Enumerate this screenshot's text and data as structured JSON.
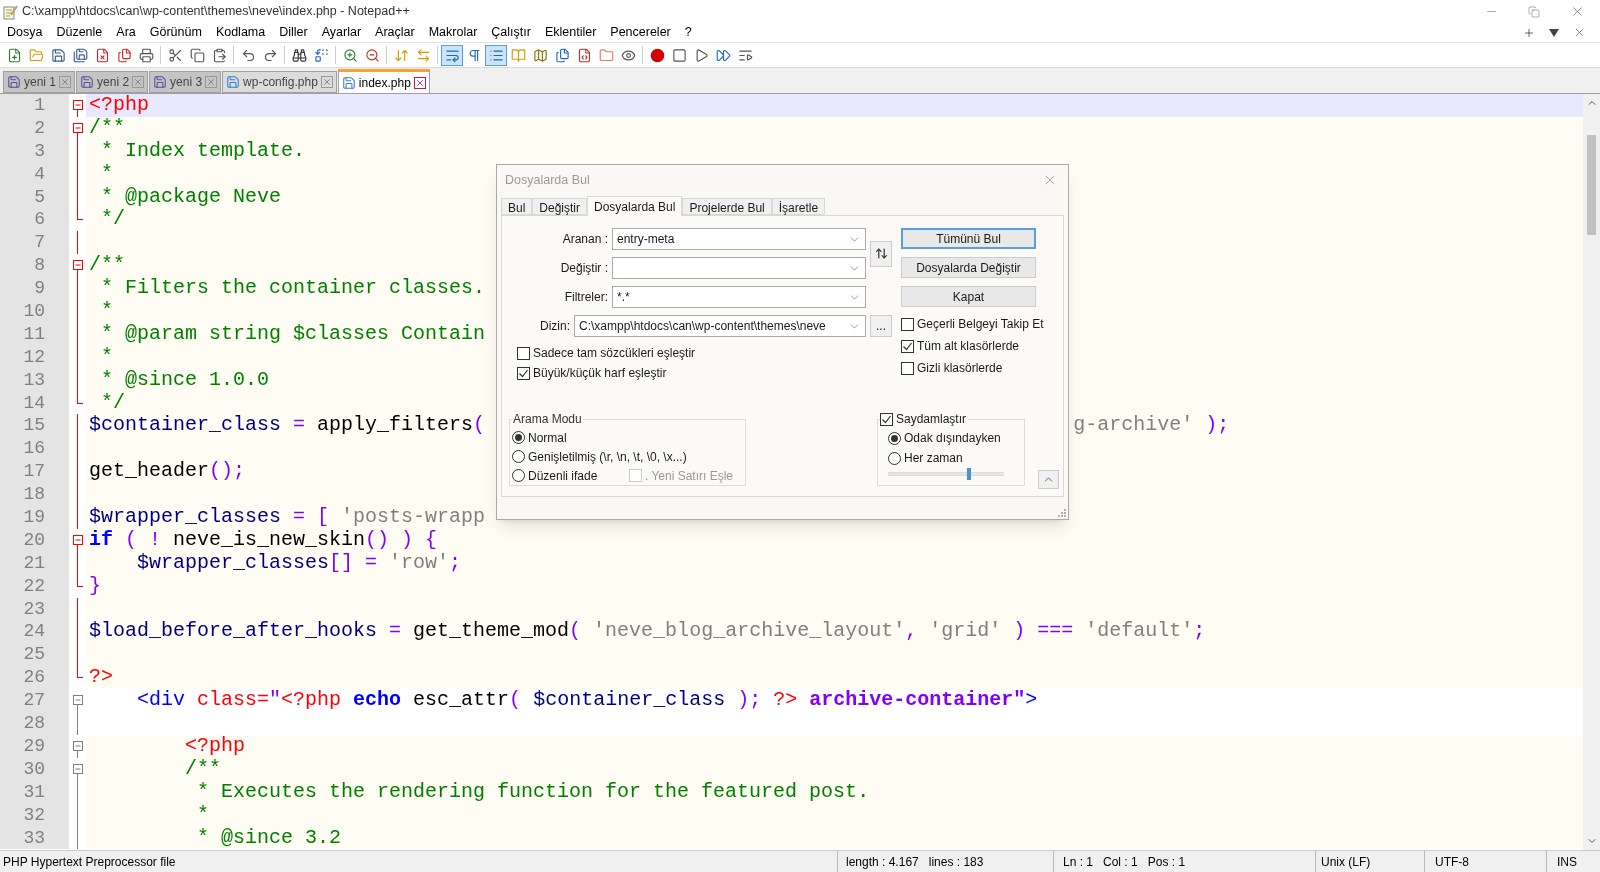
{
  "window": {
    "title": "C:\\xampp\\htdocs\\can\\wp-content\\themes\\neve\\index.php - Notepad++"
  },
  "menu": [
    "Dosya",
    "Düzenle",
    "Ara",
    "Görünüm",
    "Kodlama",
    "Diller",
    "Ayarlar",
    "Araçlar",
    "Makrolar",
    "Çalıştır",
    "Eklentiler",
    "Pencereler",
    "?"
  ],
  "toolbar": [
    [
      {
        "kind": "new",
        "pressed": false
      },
      {
        "kind": "open",
        "pressed": false
      },
      {
        "kind": "save",
        "pressed": false
      },
      {
        "kind": "save-all",
        "pressed": false
      },
      {
        "kind": "close",
        "pressed": false
      },
      {
        "kind": "close-all",
        "pressed": false
      },
      {
        "kind": "print",
        "pressed": false
      }
    ],
    [
      {
        "kind": "cut",
        "pressed": false
      },
      {
        "kind": "copy",
        "pressed": false
      },
      {
        "kind": "paste",
        "pressed": false
      }
    ],
    [
      {
        "kind": "undo",
        "pressed": false
      },
      {
        "kind": "redo",
        "pressed": false
      }
    ],
    [
      {
        "kind": "find",
        "pressed": false
      },
      {
        "kind": "replace",
        "pressed": false
      }
    ],
    [
      {
        "kind": "zoom-in",
        "pressed": false
      },
      {
        "kind": "zoom-out",
        "pressed": false
      }
    ],
    [
      {
        "kind": "sync-v",
        "pressed": false
      },
      {
        "kind": "sync-h",
        "pressed": false
      }
    ],
    [
      {
        "kind": "wrap",
        "pressed": true
      },
      {
        "kind": "all-chars",
        "pressed": false
      },
      {
        "kind": "indent-guide",
        "pressed": true
      },
      {
        "kind": "udl",
        "pressed": false
      },
      {
        "kind": "doc-map",
        "pressed": false
      },
      {
        "kind": "doc-list",
        "pressed": false
      },
      {
        "kind": "function-list",
        "pressed": false
      },
      {
        "kind": "workspace",
        "pressed": false
      },
      {
        "kind": "monitor",
        "pressed": false
      }
    ],
    [
      {
        "kind": "record",
        "pressed": false
      },
      {
        "kind": "stop",
        "pressed": false
      },
      {
        "kind": "play",
        "pressed": false
      },
      {
        "kind": "play-multi",
        "pressed": false
      },
      {
        "kind": "save-macro",
        "pressed": false
      }
    ]
  ],
  "tabs": [
    {
      "label": "yeni 1",
      "kind": "new",
      "selected": false
    },
    {
      "label": "yeni 2",
      "kind": "new",
      "selected": false
    },
    {
      "label": "yeni 3",
      "kind": "new",
      "selected": false
    },
    {
      "label": "wp-config.php",
      "kind": "file",
      "selected": false
    },
    {
      "label": "index.php",
      "kind": "file",
      "selected": true
    }
  ],
  "editor": {
    "lines": [
      {
        "number": "1",
        "kind": "open",
        "php_block": true,
        "current": true,
        "tokens": [
          {
            "kind": "tag",
            "text": "<?php"
          }
        ]
      },
      {
        "number": "2",
        "kind": "open",
        "php_block": true,
        "shaded": true,
        "current": false,
        "tokens": [
          {
            "kind": "comment",
            "text": "/**"
          }
        ]
      },
      {
        "number": "3",
        "kind": "body",
        "php_block": true,
        "shaded": true,
        "current": false,
        "tokens": [
          {
            "kind": "comment",
            "text": " * Index template."
          }
        ]
      },
      {
        "number": "4",
        "kind": "body",
        "php_block": true,
        "shaded": true,
        "current": false,
        "tokens": [
          {
            "kind": "comment",
            "text": " *"
          }
        ]
      },
      {
        "number": "5",
        "kind": "body",
        "php_block": true,
        "shaded": true,
        "current": false,
        "tokens": [
          {
            "kind": "comment",
            "text": " * @package Neve"
          }
        ]
      },
      {
        "number": "6",
        "kind": "end",
        "php_block": true,
        "shaded": true,
        "current": false,
        "tokens": [
          {
            "kind": "comment",
            "text": " */"
          }
        ]
      },
      {
        "number": "7",
        "kind": "body",
        "php_block": true,
        "shaded": true,
        "current": false
      },
      {
        "number": "8",
        "kind": "open",
        "php_block": true,
        "shaded": true,
        "current": false,
        "tokens": [
          {
            "kind": "comment",
            "text": "/**"
          }
        ]
      },
      {
        "number": "9",
        "kind": "body",
        "php_block": true,
        "shaded": true,
        "current": false,
        "tokens": [
          {
            "kind": "comment",
            "text": " * Filters the container classes."
          }
        ]
      },
      {
        "number": "10",
        "kind": "body",
        "php_block": true,
        "shaded": true,
        "current": false,
        "tokens": [
          {
            "kind": "comment",
            "text": " *"
          }
        ]
      },
      {
        "number": "11",
        "kind": "body",
        "php_block": true,
        "shaded": true,
        "current": false,
        "tokens": [
          {
            "kind": "comment",
            "text": " * @param string $classes Contain"
          }
        ]
      },
      {
        "number": "12",
        "kind": "body",
        "php_block": true,
        "shaded": true,
        "current": false,
        "tokens": [
          {
            "kind": "comment",
            "text": " *"
          }
        ]
      },
      {
        "number": "13",
        "kind": "body",
        "php_block": true,
        "shaded": true,
        "current": false,
        "tokens": [
          {
            "kind": "comment",
            "text": " * @since 1.0.0"
          }
        ]
      },
      {
        "number": "14",
        "kind": "end",
        "php_block": true,
        "shaded": true,
        "current": false,
        "tokens": [
          {
            "kind": "comment",
            "text": " */"
          }
        ]
      },
      {
        "number": "15",
        "kind": "body",
        "php_block": true,
        "shaded": true,
        "current": false,
        "tokens": [
          {
            "kind": "variable",
            "text": "$container_class"
          },
          {
            "kind": "operator",
            "text": " = "
          },
          {
            "kind": "plain",
            "text": "apply_filters"
          },
          {
            "kind": "operator",
            "text": "("
          },
          {
            "kind": "covered"
          },
          {
            "kind": "string",
            "text": "g-archive'"
          },
          {
            "kind": "operator",
            "text": " );"
          }
        ]
      },
      {
        "number": "16",
        "kind": "body",
        "php_block": true,
        "shaded": true,
        "current": false
      },
      {
        "number": "17",
        "kind": "body",
        "php_block": true,
        "shaded": true,
        "current": false,
        "tokens": [
          {
            "kind": "plain",
            "text": "get_header"
          },
          {
            "kind": "operator",
            "text": "();"
          }
        ]
      },
      {
        "number": "18",
        "kind": "body",
        "php_block": true,
        "shaded": true,
        "current": false
      },
      {
        "number": "19",
        "kind": "body",
        "php_block": true,
        "shaded": true,
        "current": false,
        "tokens": [
          {
            "kind": "variable",
            "text": "$wrapper_classes"
          },
          {
            "kind": "operator",
            "text": " = [ "
          },
          {
            "kind": "string",
            "text": "'posts-wrapp"
          }
        ]
      },
      {
        "number": "20",
        "kind": "open",
        "php_block": true,
        "shaded": true,
        "current": false,
        "tokens": [
          {
            "kind": "keyword",
            "text": "if"
          },
          {
            "kind": "operator",
            "text": " ( ! "
          },
          {
            "kind": "plain",
            "text": "neve_is_new_skin"
          },
          {
            "kind": "operator",
            "text": "() ) {"
          }
        ]
      },
      {
        "number": "21",
        "kind": "body",
        "php_block": true,
        "shaded": true,
        "current": false,
        "tokens": [
          {
            "kind": "variable",
            "text": "    $wrapper_classes"
          },
          {
            "kind": "operator",
            "text": "[] = "
          },
          {
            "kind": "string",
            "text": "'row'"
          },
          {
            "kind": "operator",
            "text": ";"
          }
        ]
      },
      {
        "number": "22",
        "kind": "end",
        "php_block": true,
        "shaded": true,
        "current": false,
        "tokens": [
          {
            "kind": "operator",
            "text": "}"
          }
        ]
      },
      {
        "number": "23",
        "kind": "body",
        "php_block": true,
        "shaded": true,
        "current": false
      },
      {
        "number": "24",
        "kind": "body",
        "php_block": true,
        "shaded": true,
        "current": false,
        "tokens": [
          {
            "kind": "variable",
            "text": "$load_before_after_hooks"
          },
          {
            "kind": "operator",
            "text": " = "
          },
          {
            "kind": "plain",
            "text": "get_theme_mod"
          },
          {
            "kind": "operator",
            "text": "( "
          },
          {
            "kind": "string",
            "text": "'neve_blog_archive_layout'"
          },
          {
            "kind": "operator",
            "text": ", "
          },
          {
            "kind": "string",
            "text": "'grid'"
          },
          {
            "kind": "operator",
            "text": " ) === "
          },
          {
            "kind": "string",
            "text": "'default'"
          },
          {
            "kind": "operator",
            "text": ";"
          }
        ]
      },
      {
        "number": "25",
        "kind": "body",
        "php_block": true,
        "shaded": true,
        "current": false
      },
      {
        "number": "26",
        "kind": "end",
        "php_block": true,
        "shaded": true,
        "current": false,
        "tokens": [
          {
            "kind": "tag",
            "text": "?>"
          }
        ]
      },
      {
        "number": "27",
        "kind": "open",
        "php_block": false,
        "shaded": false,
        "current": false,
        "tokens": [
          {
            "kind": "html-tag",
            "text": "    <div"
          },
          {
            "kind": "attribute",
            "text": " class="
          },
          {
            "kind": "html-string",
            "text": "\""
          },
          {
            "kind": "tag",
            "text": "<?php"
          },
          {
            "kind": "keyword",
            "text": " echo"
          },
          {
            "kind": "plain",
            "text": " esc_attr"
          },
          {
            "kind": "operator",
            "text": "( "
          },
          {
            "kind": "variable",
            "text": "$container_class"
          },
          {
            "kind": "operator",
            "text": " ); "
          },
          {
            "kind": "tag",
            "text": "?>"
          },
          {
            "kind": "html-string-bold",
            "text": " archive-container\""
          },
          {
            "kind": "html-tag",
            "text": ">"
          }
        ]
      },
      {
        "number": "28",
        "kind": "body",
        "php_block": false,
        "shaded": false,
        "current": false
      },
      {
        "number": "29",
        "kind": "open",
        "php_block": false,
        "shaded": true,
        "current": false,
        "tokens": [
          {
            "kind": "tag",
            "text": "        <?php"
          }
        ]
      },
      {
        "number": "30",
        "kind": "open",
        "php_block": false,
        "shaded": true,
        "current": false,
        "tokens": [
          {
            "kind": "comment",
            "text": "        /**"
          }
        ]
      },
      {
        "number": "31",
        "kind": "body",
        "php_block": false,
        "shaded": true,
        "current": false,
        "tokens": [
          {
            "kind": "comment",
            "text": "         * Executes the rendering function for the featured post."
          }
        ]
      },
      {
        "number": "32",
        "kind": "body",
        "php_block": false,
        "shaded": true,
        "current": false,
        "tokens": [
          {
            "kind": "comment",
            "text": "         *"
          }
        ]
      },
      {
        "number": "33",
        "kind": "body",
        "php_block": false,
        "shaded": true,
        "current": false,
        "tokens": [
          {
            "kind": "comment",
            "text": "         * @since 3.2"
          }
        ]
      }
    ]
  },
  "dialog": {
    "title": "Dosyalarda Bul",
    "tabs": [
      {
        "label": "Bul",
        "selected": false
      },
      {
        "label": "Değiştir",
        "selected": false
      },
      {
        "label": "Dosyalarda Bul",
        "selected": true
      },
      {
        "label": "Projelerde Bul",
        "selected": false
      },
      {
        "label": "İşaretle",
        "selected": false
      }
    ],
    "fields": [
      {
        "kind": "search",
        "label": "Aranan :",
        "value": "entry-meta"
      },
      {
        "kind": "replace",
        "label": "Değiştir :"
      },
      {
        "kind": "filter",
        "label": "Filtreler:",
        "value": "*.*"
      },
      {
        "kind": "directory",
        "label": "Dizin:",
        "value": "C:\\xampp\\htdocs\\can\\wp-content\\themes\\neve",
        "button": "..."
      }
    ],
    "buttons": [
      {
        "label": "Tümünü Bul",
        "focused": true
      },
      {
        "label": "Dosyalarda Değiştir",
        "focused": false
      },
      {
        "label": "Kapat",
        "focused": false
      }
    ],
    "left_options": [
      {
        "label": "Sadece tam sözcükleri eşleştir",
        "checked": false
      },
      {
        "label": "Büyük/küçük harf eşleştir",
        "checked": true
      }
    ],
    "right_options": [
      {
        "label": "Geçerli Belgeyi Takip Et",
        "checked": false
      },
      {
        "label": "Tüm alt klasörlerde",
        "checked": true
      },
      {
        "label": "Gizli klasörlerde",
        "checked": false
      }
    ],
    "search_mode": {
      "title": "Arama Modu",
      "options": [
        {
          "label": "Normal",
          "selected": true
        },
        {
          "label": "Genişletilmiş (\\r, \\n, \\t, \\0, \\x...)",
          "selected": false
        },
        {
          "label": "Düzenli ifade",
          "selected": false
        }
      ],
      "newline": {
        "label": ". Yeni Satırı Eşle",
        "checked": false,
        "disabled": true
      }
    },
    "transparency": {
      "label": "Saydamlaştır",
      "checked": true,
      "options": [
        {
          "label": "Odak dışındayken",
          "selected": true
        },
        {
          "label": "Her zaman",
          "selected": false
        }
      ],
      "level": 0.7
    }
  },
  "status_bar": {
    "doc_type": "PHP Hypertext Preprocessor file",
    "length": "length : 4.167",
    "lines": "lines : 183",
    "ln": "Ln : 1",
    "col": "Col : 1",
    "pos": "Pos : 1",
    "eol": "Unix (LF)",
    "encoding": "UTF-8",
    "mode": "INS"
  }
}
